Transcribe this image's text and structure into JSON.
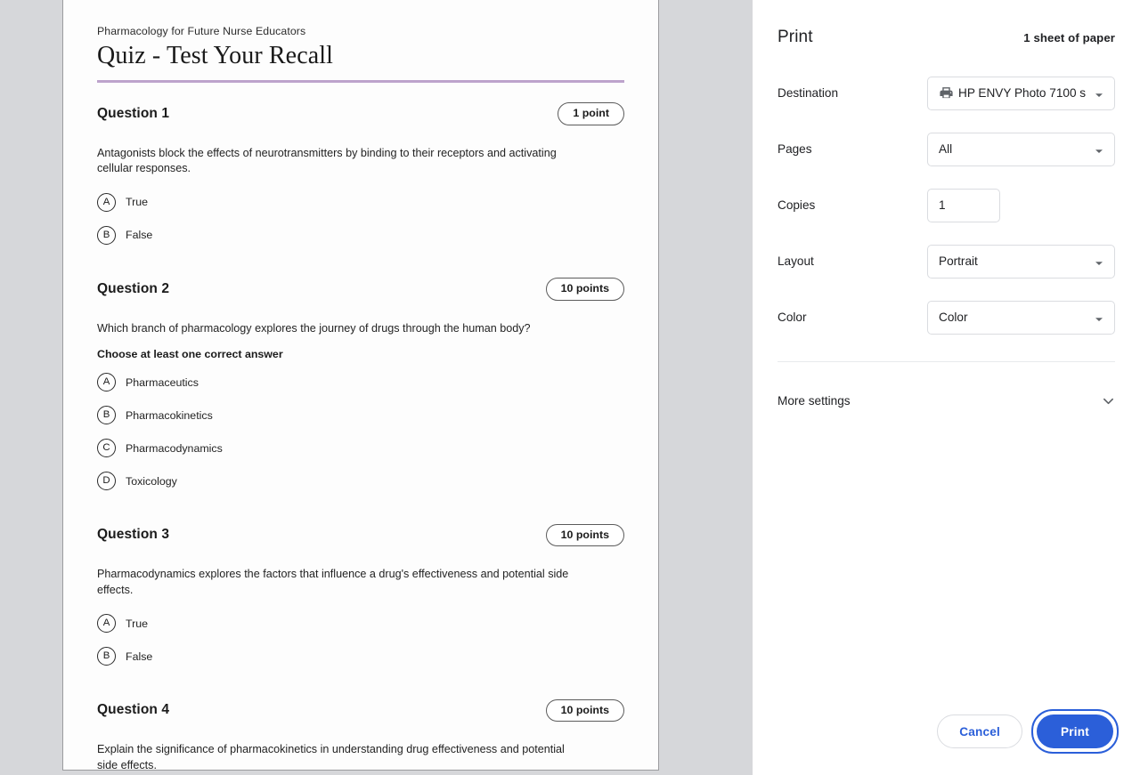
{
  "document": {
    "kicker": "Pharmacology for Future Nurse Educators",
    "title": "Quiz - Test Your Recall",
    "questions": [
      {
        "heading": "Question 1",
        "points": "1 point",
        "prompt": "Antagonists block the effects of neurotransmitters by binding to their receptors and activating cellular responses.",
        "instruction": "",
        "options": [
          {
            "letter": "A",
            "text": "True"
          },
          {
            "letter": "B",
            "text": "False"
          }
        ]
      },
      {
        "heading": "Question 2",
        "points": "10 points",
        "prompt": "Which branch of pharmacology explores the journey of drugs through the human body?",
        "instruction": "Choose at least one correct answer",
        "options": [
          {
            "letter": "A",
            "text": "Pharmaceutics"
          },
          {
            "letter": "B",
            "text": "Pharmacokinetics"
          },
          {
            "letter": "C",
            "text": "Pharmacodynamics"
          },
          {
            "letter": "D",
            "text": "Toxicology"
          }
        ]
      },
      {
        "heading": "Question 3",
        "points": "10 points",
        "prompt": "Pharmacodynamics explores the factors that influence a drug's effectiveness and potential side effects.",
        "instruction": "",
        "options": [
          {
            "letter": "A",
            "text": "True"
          },
          {
            "letter": "B",
            "text": "False"
          }
        ]
      },
      {
        "heading": "Question 4",
        "points": "10 points",
        "prompt": "Explain the significance of pharmacokinetics in understanding drug effectiveness and potential side effects.",
        "instruction": "",
        "options": []
      }
    ]
  },
  "print_dialog": {
    "title": "Print",
    "sheet_summary": "1 sheet of paper",
    "settings": {
      "destination": {
        "label": "Destination",
        "value": "HP ENVY Photo 7100 s",
        "icon": "printer-icon"
      },
      "pages": {
        "label": "Pages",
        "value": "All"
      },
      "copies": {
        "label": "Copies",
        "value": "1"
      },
      "layout": {
        "label": "Layout",
        "value": "Portrait"
      },
      "color": {
        "label": "Color",
        "value": "Color"
      }
    },
    "more_settings": {
      "label": "More settings",
      "icon": "chevron-down-icon"
    },
    "actions": {
      "cancel": "Cancel",
      "print": "Print"
    },
    "colors": {
      "accent": "#2b5fd9",
      "panel_bg": "#ffffff",
      "preview_bg": "#d6d7da",
      "title_rule": "#bda3cc"
    }
  }
}
